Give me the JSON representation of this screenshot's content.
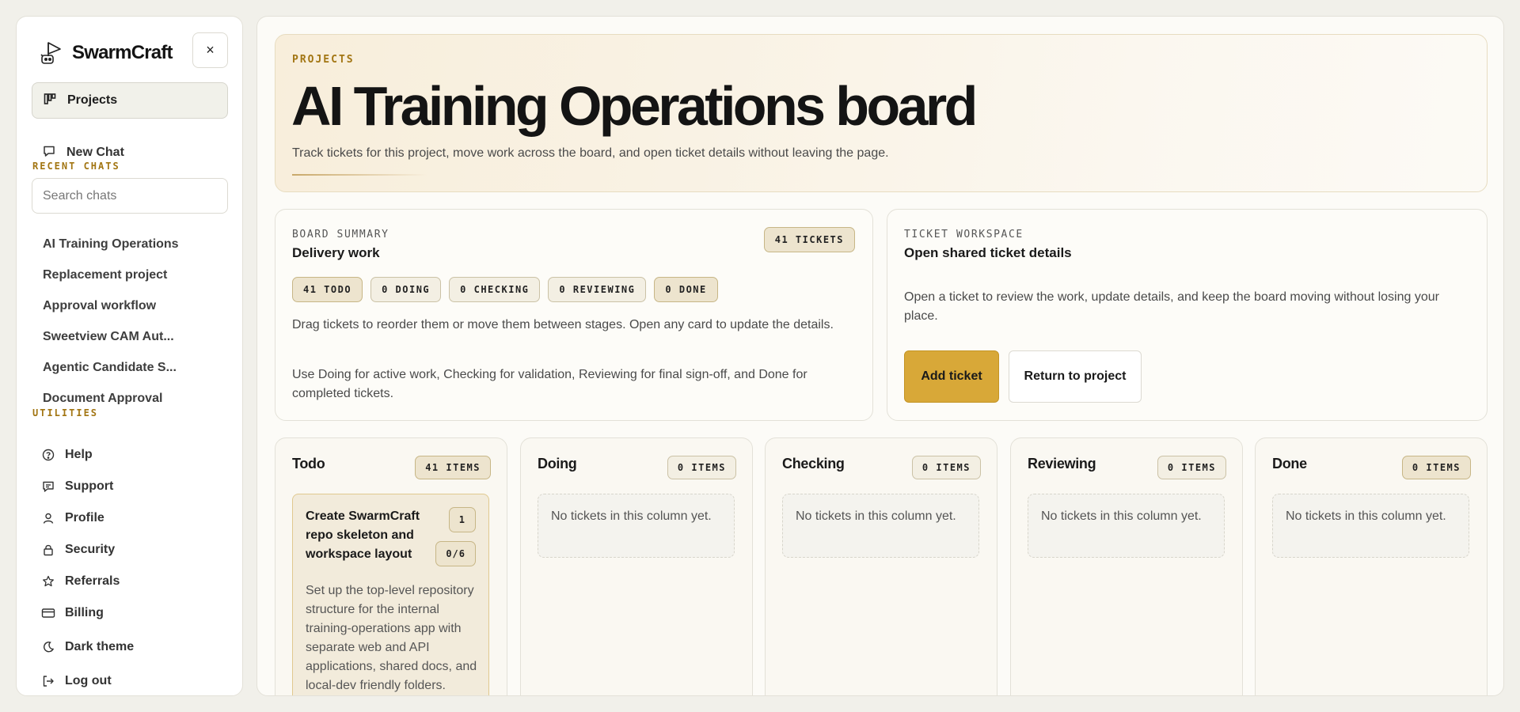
{
  "app": {
    "name": "SwarmCraft",
    "close_label": "×"
  },
  "sidebar": {
    "projects_label": "Projects",
    "new_chat_label": "New Chat",
    "recent_label": "RECENT CHATS",
    "search_placeholder": "Search chats",
    "recent_chats": [
      "AI Training Operations",
      "Replacement project",
      "Approval workflow",
      "Sweetview CAM Aut...",
      "Agentic Candidate S...",
      "Document Approval"
    ],
    "utilities_label": "UTILITIES",
    "utilities": [
      {
        "label": "Help",
        "icon": "help-circle-icon"
      },
      {
        "label": "Support",
        "icon": "chat-bubble-icon"
      },
      {
        "label": "Profile",
        "icon": "user-icon"
      },
      {
        "label": "Security",
        "icon": "lock-icon"
      },
      {
        "label": "Referrals",
        "icon": "star-icon"
      },
      {
        "label": "Billing",
        "icon": "credit-card-icon"
      },
      {
        "label": "Dark theme",
        "icon": "moon-icon"
      },
      {
        "label": "Log out",
        "icon": "logout-icon"
      }
    ]
  },
  "hero": {
    "kicker": "PROJECTS",
    "title": "AI Training Operations board",
    "description": "Track tickets for this project, move work across the board, and open ticket details without leaving the page."
  },
  "summary": {
    "kicker": "BOARD SUMMARY",
    "title": "Delivery work",
    "tickets_badge": "41 TICKETS",
    "statuses": [
      "41 TODO",
      "0 DOING",
      "0 CHECKING",
      "0 REVIEWING",
      "0 DONE"
    ],
    "text1": "Drag tickets to reorder them or move them between stages. Open any card to update the details.",
    "text2": "Use Doing for active work, Checking for validation, Reviewing for final sign-off, and Done for completed tickets."
  },
  "workspace": {
    "kicker": "TICKET WORKSPACE",
    "title": "Open shared ticket details",
    "text": "Open a ticket to review the work, update details, and keep the board moving without losing your place.",
    "add_label": "Add ticket",
    "return_label": "Return to project"
  },
  "columns": [
    {
      "title": "Todo",
      "count": "41 ITEMS"
    },
    {
      "title": "Doing",
      "count": "0 ITEMS"
    },
    {
      "title": "Checking",
      "count": "0 ITEMS"
    },
    {
      "title": "Reviewing",
      "count": "0 ITEMS"
    },
    {
      "title": "Done",
      "count": "0 ITEMS"
    }
  ],
  "empty_text": "No tickets in this column yet.",
  "ticket": {
    "title": "Create SwarmCraft repo skeleton and workspace layout",
    "number": "1",
    "progress": "0/6",
    "description": "Set up the top-level repository structure for the internal training-operations app with separate web and API applications, shared docs, and local-dev friendly folders."
  },
  "colors": {
    "accent": "#d8a838",
    "kicker": "#a27512"
  }
}
